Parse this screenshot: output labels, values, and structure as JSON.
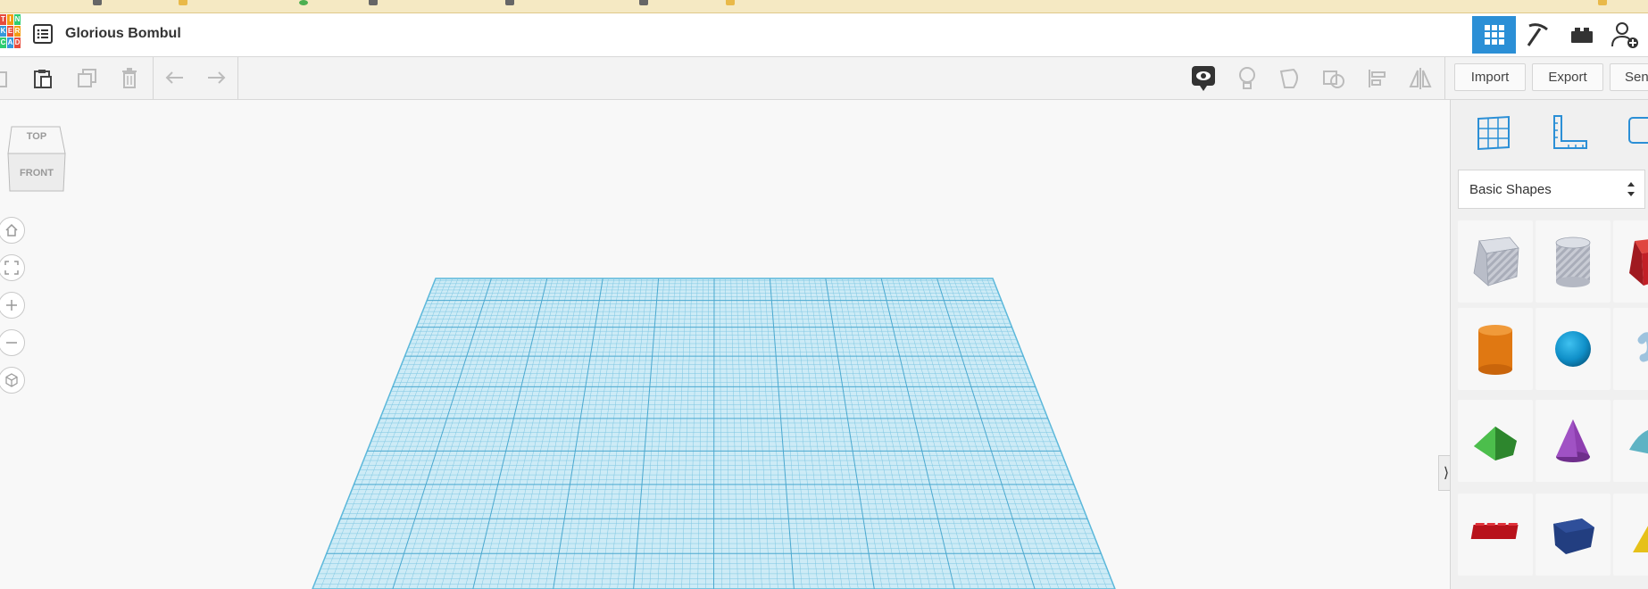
{
  "design": {
    "title": "Glorious Bombul"
  },
  "logo": {
    "letters": [
      "T",
      "I",
      "N",
      "K",
      "E",
      "R",
      "C",
      "A",
      "D"
    ]
  },
  "topnav": [
    {
      "name": "3d-design-view",
      "icon": "grid-icon",
      "active": true
    },
    {
      "name": "codeblocks-view",
      "icon": "pickaxe-icon",
      "active": false
    },
    {
      "name": "bricks-view",
      "icon": "brick-icon",
      "active": false
    },
    {
      "name": "share-design",
      "icon": "add-user-icon",
      "active": false
    }
  ],
  "toolbar": {
    "import_label": "Import",
    "export_label": "Export",
    "send_label": "Send To"
  },
  "viewcube": {
    "top_label": "TOP",
    "front_label": "FRONT"
  },
  "shapes_panel": {
    "library": "Basic Shapes",
    "tools": [
      "workplane-icon",
      "ruler-icon",
      "notes-icon"
    ],
    "shapes": [
      {
        "name": "box-hole"
      },
      {
        "name": "cylinder-hole"
      },
      {
        "name": "box"
      },
      {
        "name": "cylinder"
      },
      {
        "name": "sphere"
      },
      {
        "name": "scribble"
      },
      {
        "name": "roof"
      },
      {
        "name": "cone"
      },
      {
        "name": "round-roof"
      },
      {
        "name": "text"
      },
      {
        "name": "polygon"
      },
      {
        "name": "pyramid"
      }
    ]
  },
  "colors": {
    "accent": "#2b8fd6",
    "grid_fill": "#cdebf6",
    "grid_line": "#5ab7da",
    "panel_bg": "#f0f0f0"
  }
}
